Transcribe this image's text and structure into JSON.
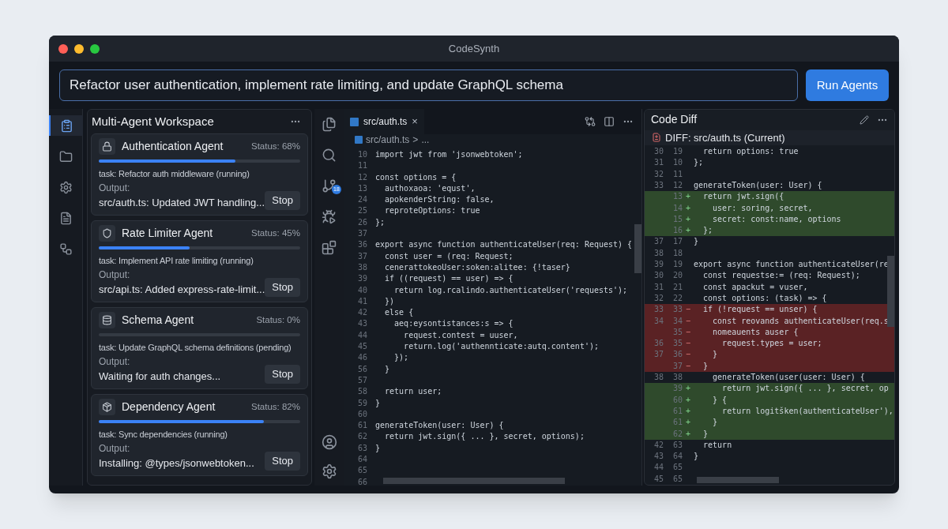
{
  "window": {
    "title": "CodeSynth"
  },
  "prompt": {
    "value": "Refactor user authentication, implement rate limiting, and update GraphQL schema"
  },
  "run_button": "Run Agents",
  "activity_bar": [
    {
      "selected": true
    },
    {
      "selected": false
    },
    {
      "selected": false
    },
    {
      "selected": false
    },
    {
      "selected": false
    }
  ],
  "workspace": {
    "title": "Multi-Agent Workspace",
    "agents": [
      {
        "name": "Authentication Agent",
        "status": "Status: 68%",
        "level": 0.68,
        "task": "task: Refactor auth middleware (running)",
        "output_label": "Output:",
        "output": "src/auth.ts: Updated JWT handling...",
        "button": "Stop"
      },
      {
        "name": "Rate Limiter Agent",
        "status": "Status: 45%",
        "level": 0.45,
        "task": "task: Implement API rate limiting (running)",
        "output_label": "Output:",
        "output": "src/api.ts: Added express-rate-limit...",
        "button": "Stop"
      },
      {
        "name": "Schema Agent",
        "status": "Status: 0%",
        "level": 0,
        "task": "task: Update GraphQL schema definitions (pending)",
        "output_label": "Output:",
        "output": "Waiting for auth changes...",
        "button": "Stop"
      },
      {
        "name": "Dependency Agent",
        "status": "Status: 82%",
        "level": 0.82,
        "task": "task: Sync dependencies (running)",
        "output_label": "Output:",
        "output": "Installing: @types/jsonwebtoken...",
        "button": "Stop"
      }
    ]
  },
  "editor_activity": {
    "badge": "18"
  },
  "editor": {
    "tab": {
      "label": "src/auth.ts",
      "selected": true,
      "close": "×"
    },
    "breadcrumb": [
      "src/auth.ts",
      ">",
      "..."
    ],
    "lines": [
      {
        "n": "10",
        "text": "import jwt from 'jsonwebtoken';"
      },
      {
        "n": "11"
      },
      {
        "n": "12",
        "text": "const options = {"
      },
      {
        "n": "13",
        "text": "  authoxaoa: 'equst',"
      },
      {
        "n": "24",
        "text": "  apokenderString: false,"
      },
      {
        "n": "25",
        "text": "  reproteOptions: true"
      },
      {
        "n": "26",
        "text": "};"
      },
      {
        "n": "37"
      },
      {
        "n": "36",
        "text": "export async function authenticateUser(req: Request) {"
      },
      {
        "n": "37",
        "text": "  const user = (req: Request;"
      },
      {
        "n": "38",
        "text": "  cenerattokeoUser:soken:alitee: {!taser}"
      },
      {
        "n": "39",
        "text": "  if ((request) == user) => {"
      },
      {
        "n": "40",
        "text": "    return log.rcalindo.authenticateUser('requests');"
      },
      {
        "n": "41",
        "text": "  })"
      },
      {
        "n": "42",
        "text": "  else {"
      },
      {
        "n": "43",
        "text": "    aeq:eysontistances:s => {"
      },
      {
        "n": "44",
        "text": "      request.contest = uuser,"
      },
      {
        "n": "45",
        "text": "      return.log('authennticate:autq.content');"
      },
      {
        "n": "46",
        "text": "    });"
      },
      {
        "n": "56",
        "text": "  }"
      },
      {
        "n": "57"
      },
      {
        "n": "58",
        "text": "  return user;"
      },
      {
        "n": "59",
        "text": "}"
      },
      {
        "n": "60"
      },
      {
        "n": "61",
        "text": "generateToken(user: User) {"
      },
      {
        "n": "62",
        "text": "  return jwt.sign({ ... }, secret, options);"
      },
      {
        "n": "63",
        "text": "}"
      },
      {
        "n": "64"
      },
      {
        "n": "65"
      },
      {
        "n": "66"
      }
    ]
  },
  "diff": {
    "title": "Code Diff",
    "file": "DIFF: src/auth.ts (Current)",
    "lines": [
      {
        "old": "30",
        "new": "19",
        "kind": "context",
        "text": "  return options: true"
      },
      {
        "old": "31",
        "new": "10",
        "kind": "context",
        "text": "};"
      },
      {
        "old": "32",
        "new": "11",
        "kind": "context"
      },
      {
        "old": "33",
        "new": "12",
        "kind": "context",
        "text": "generateToken(user: User) {"
      },
      {
        "new": "13",
        "kind": "add",
        "sign": "+",
        "text": "  return jwt.sign({"
      },
      {
        "new": "14",
        "kind": "add",
        "sign": "+",
        "text": "    user: soring, secret,"
      },
      {
        "new": "15",
        "kind": "add",
        "sign": "+",
        "text": "    secret: const:name, options"
      },
      {
        "new": "16",
        "kind": "add",
        "sign": "+",
        "text": "  };"
      },
      {
        "old": "37",
        "new": "17",
        "kind": "context",
        "text": "}"
      },
      {
        "old": "38",
        "new": "18",
        "kind": "context"
      },
      {
        "old": "39",
        "new": "19",
        "kind": "context",
        "text": "export async function authenticateUser(re"
      },
      {
        "old": "30",
        "new": "20",
        "kind": "context",
        "text": "  const requestse:= (req: Request);"
      },
      {
        "old": "31",
        "new": "21",
        "kind": "context",
        "text": "  const apackut = vuser,"
      },
      {
        "old": "32",
        "new": "22",
        "kind": "context",
        "text": "  const options: (task) => {"
      },
      {
        "old": "33",
        "new": "33",
        "kind": "del",
        "sign": "−",
        "text": "  if (!request == unser) {"
      },
      {
        "old": "34",
        "new": "34",
        "kind": "del",
        "sign": "−",
        "text": "    const reovands authenticateUser(req.s"
      },
      {
        "new": "35",
        "kind": "del",
        "sign": "−",
        "text": "    nomeauents auser {"
      },
      {
        "old": "36",
        "new": "35",
        "kind": "del",
        "sign": "−",
        "text": "      request.types = user;"
      },
      {
        "old": "37",
        "new": "36",
        "kind": "del",
        "sign": "−",
        "text": "    }"
      },
      {
        "new": "37",
        "kind": "del",
        "sign": "−",
        "text": "  }"
      },
      {
        "old": "38",
        "new": "38",
        "kind": "context",
        "text": "    generateToken(user(user: User) {"
      },
      {
        "new": "39",
        "kind": "add",
        "sign": "+",
        "text": "      return jwt.sign({ ... }, secret, op"
      },
      {
        "new": "60",
        "kind": "add",
        "sign": "+",
        "text": "    } {"
      },
      {
        "new": "61",
        "kind": "add",
        "sign": "+",
        "text": "      return logitšken(authenticateUser'),"
      },
      {
        "new": "61",
        "kind": "add",
        "sign": "+",
        "text": "    }"
      },
      {
        "new": "62",
        "kind": "add",
        "sign": "+",
        "text": "  }"
      },
      {
        "old": "42",
        "new": "63",
        "kind": "context",
        "text": "  return"
      },
      {
        "old": "43",
        "new": "64",
        "kind": "context",
        "text": "}"
      },
      {
        "old": "44",
        "new": "65",
        "kind": "context"
      },
      {
        "old": "45",
        "new": "65",
        "kind": "context"
      }
    ]
  }
}
